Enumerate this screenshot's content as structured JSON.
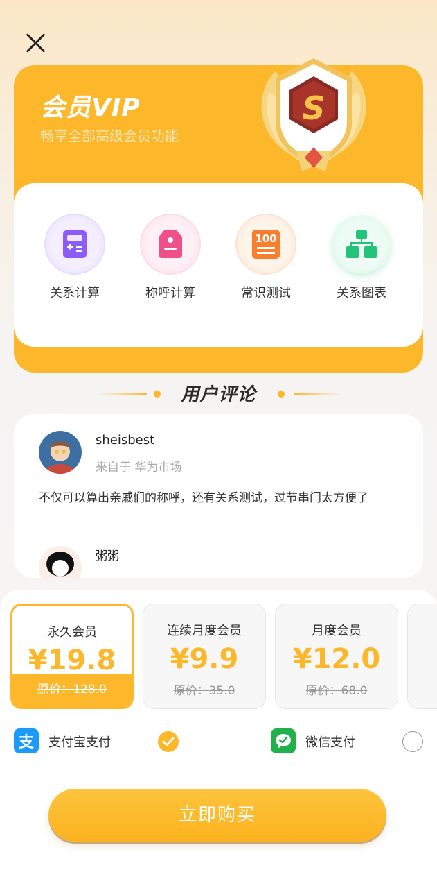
{
  "header": {
    "close_icon": "close-icon"
  },
  "vip": {
    "title": "会员VIP",
    "subtitle": "畅享全部高级会员功能",
    "badge_letter": "S"
  },
  "features": [
    {
      "label": "关系计算",
      "icon": "calculator-icon",
      "color": "#8b5cf6"
    },
    {
      "label": "称呼计算",
      "icon": "tag-icon",
      "color": "#f0508a"
    },
    {
      "label": "常识测试",
      "icon": "score-100-icon",
      "color": "#f97f2e"
    },
    {
      "label": "关系图表",
      "icon": "org-chart-icon",
      "color": "#22c47a"
    }
  ],
  "reviews": {
    "title": "用户评论",
    "items": [
      {
        "name": "sheisbest",
        "source": "来自于 华为市场",
        "text": "不仅可以算出亲戚们的称呼，还有关系测试，过节串门太方便了"
      },
      {
        "name": "粥粥"
      }
    ]
  },
  "plans": [
    {
      "name": "永久会员",
      "price": "¥19.8",
      "original": "原价：128.0",
      "selected": true
    },
    {
      "name": "连续月度会员",
      "price": "¥9.9",
      "original": "原价：35.0",
      "selected": false
    },
    {
      "name": "月度会员",
      "price": "¥12.0",
      "original": "原价：68.0",
      "selected": false
    }
  ],
  "payment": {
    "alipay_label": "支付宝支付",
    "alipay_icon_char": "支",
    "wechat_label": "微信支付",
    "selected": "alipay"
  },
  "buy_button": "立即购买",
  "colors": {
    "accent": "#fcb72a",
    "alipay": "#1a9bfc",
    "wechat": "#21b14a"
  }
}
